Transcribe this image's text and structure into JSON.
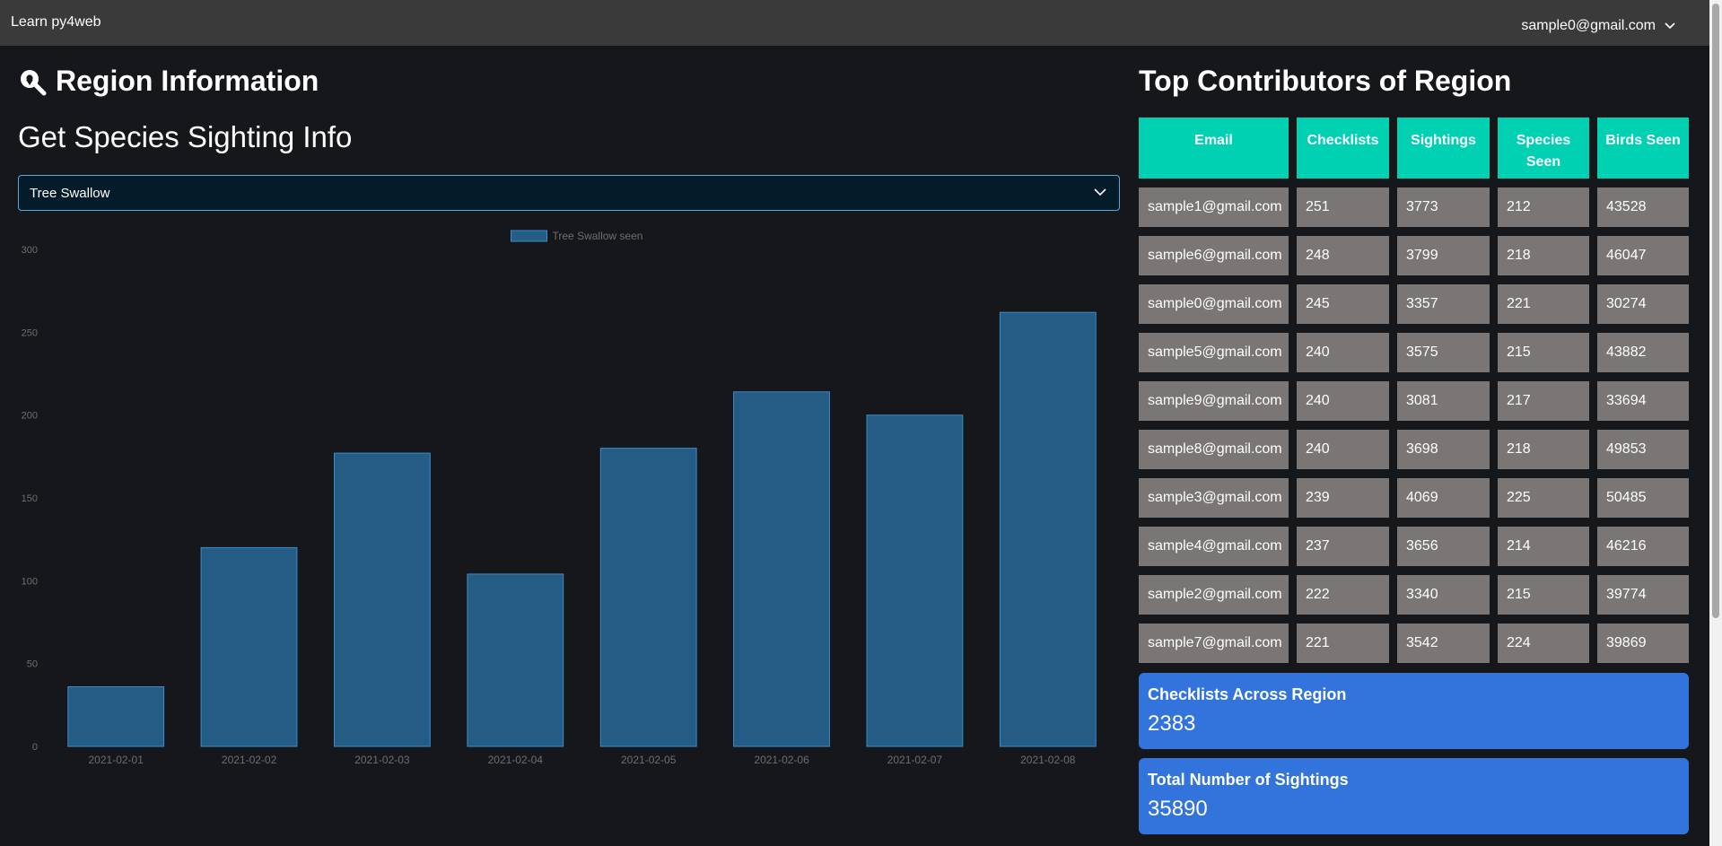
{
  "navbar": {
    "brand": "Learn py4web",
    "user_email": "sample0@gmail.com"
  },
  "left": {
    "title": "Region Information",
    "subtitle": "Get Species Sighting Info",
    "species_select": {
      "value": "Tree Swallow"
    }
  },
  "chart_data": {
    "type": "bar",
    "categories": [
      "2021-02-01",
      "2021-02-02",
      "2021-02-03",
      "2021-02-04",
      "2021-02-05",
      "2021-02-06",
      "2021-02-07",
      "2021-02-08"
    ],
    "series": [
      {
        "name": "Tree Swallow seen",
        "values": [
          36,
          120,
          177,
          104,
          180,
          214,
          200,
          262
        ]
      }
    ],
    "yticks": [
      0,
      50,
      100,
      150,
      200,
      250,
      300
    ],
    "ylim": [
      0,
      300
    ],
    "legend": "top-center",
    "grid": false,
    "colors": {
      "fill": "#245c86",
      "border": "#3a8ccc",
      "text": "#6e6e6e"
    }
  },
  "right": {
    "title": "Top Contributors of Region",
    "table": {
      "headers": [
        "Email",
        "Checklists",
        "Sightings",
        "Species Seen",
        "Birds Seen"
      ],
      "rows": [
        [
          "sample1@gmail.com",
          "251",
          "3773",
          "212",
          "43528"
        ],
        [
          "sample6@gmail.com",
          "248",
          "3799",
          "218",
          "46047"
        ],
        [
          "sample0@gmail.com",
          "245",
          "3357",
          "221",
          "30274"
        ],
        [
          "sample5@gmail.com",
          "240",
          "3575",
          "215",
          "43882"
        ],
        [
          "sample9@gmail.com",
          "240",
          "3081",
          "217",
          "33694"
        ],
        [
          "sample8@gmail.com",
          "240",
          "3698",
          "218",
          "49853"
        ],
        [
          "sample3@gmail.com",
          "239",
          "4069",
          "225",
          "50485"
        ],
        [
          "sample4@gmail.com",
          "237",
          "3656",
          "214",
          "46216"
        ],
        [
          "sample2@gmail.com",
          "222",
          "3340",
          "215",
          "39774"
        ],
        [
          "sample7@gmail.com",
          "221",
          "3542",
          "224",
          "39869"
        ]
      ]
    },
    "stats": [
      {
        "label": "Checklists Across Region",
        "value": "2383"
      },
      {
        "label": "Total Number of Sightings",
        "value": "35890"
      }
    ]
  },
  "colors": {
    "background": "#16171b",
    "navbar": "#3a3a3a",
    "table_header": "#00d1b2",
    "table_cell": "#7a7675",
    "stat_box": "#3273dc",
    "select_border": "#5aa9d6"
  },
  "icons": {
    "title_icon": "search-location-icon",
    "user_menu": "chevron-down-icon",
    "select": "chevron-down-icon"
  }
}
